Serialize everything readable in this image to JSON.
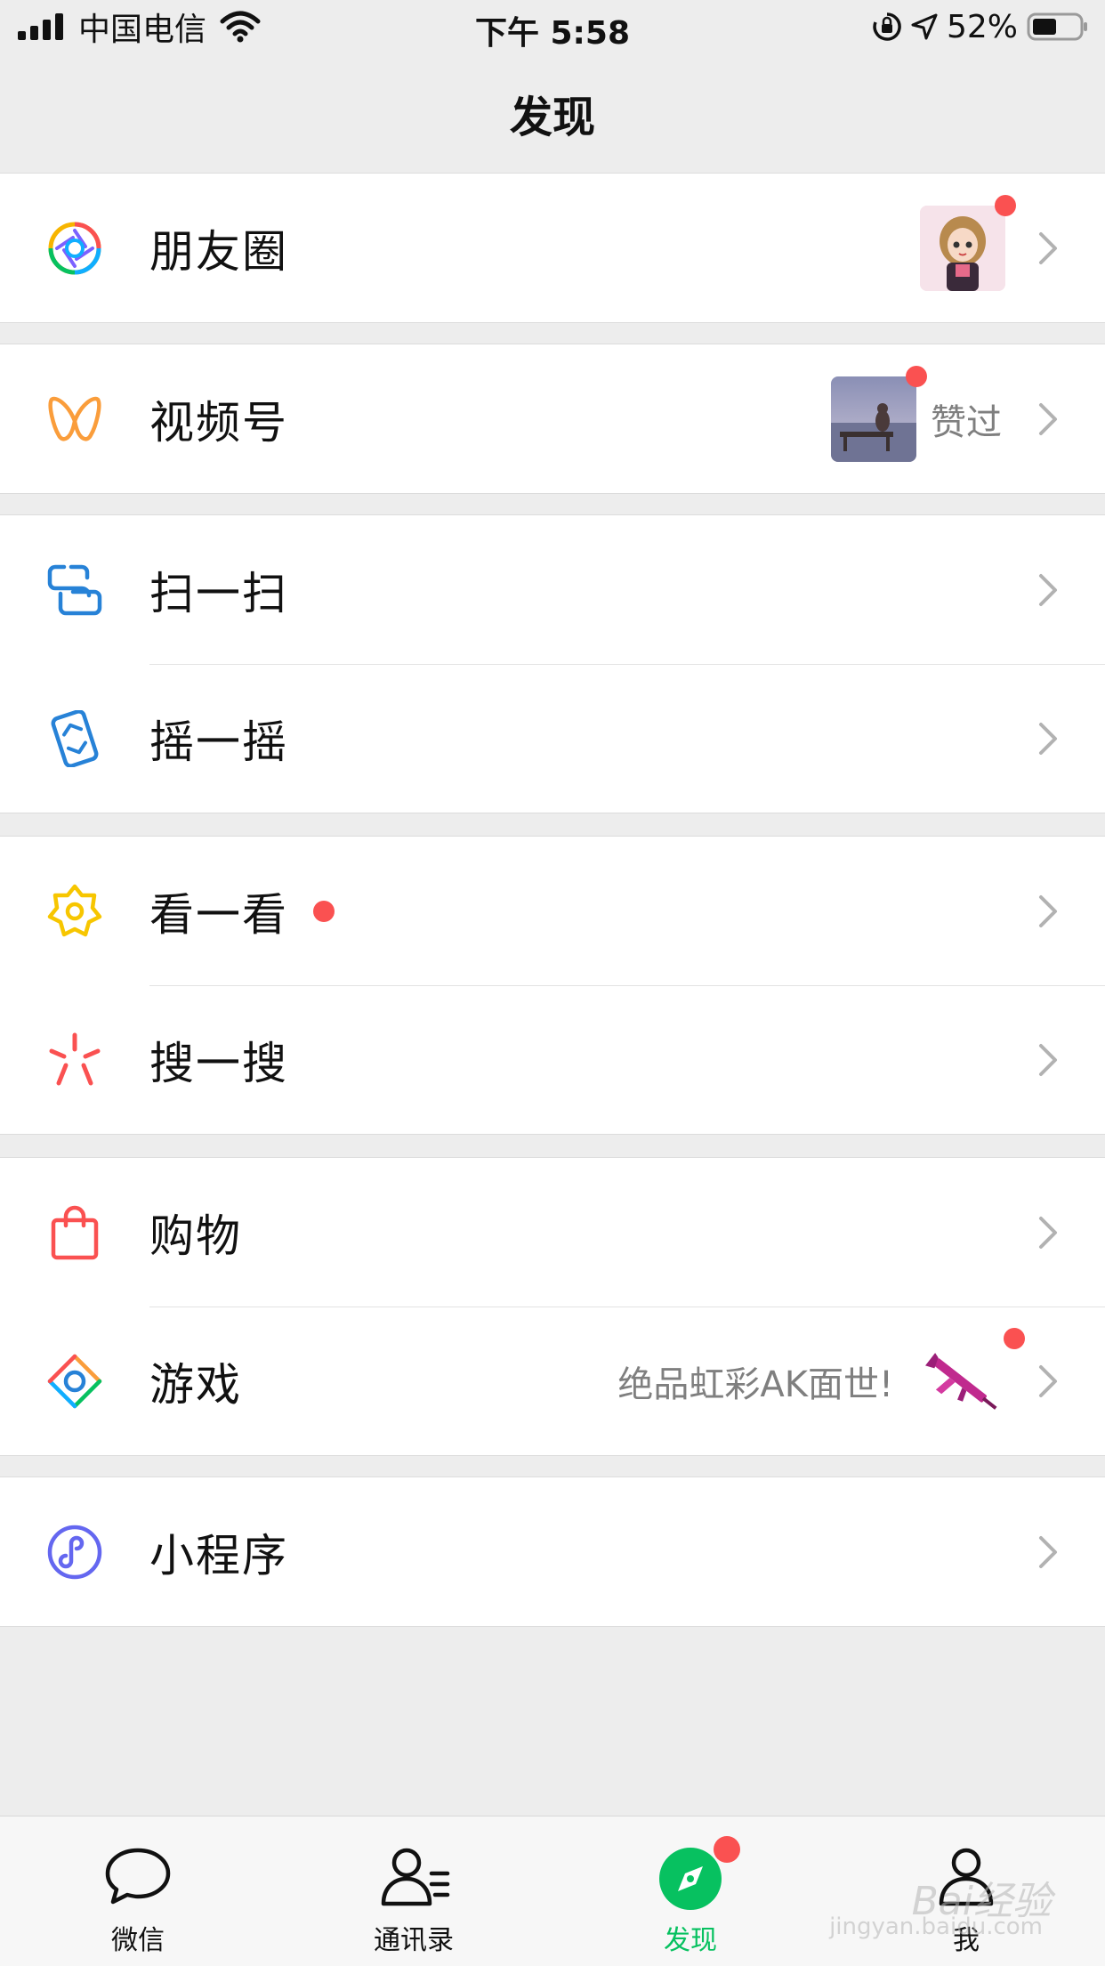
{
  "status_bar": {
    "carrier": "中国电信",
    "time": "下午 5:58",
    "battery": "52%"
  },
  "nav": {
    "title": "发现"
  },
  "groups": [
    {
      "items": [
        {
          "label": "朋友圈",
          "icon": "moments-shutter-icon",
          "has_thumb_dot": true
        }
      ]
    },
    {
      "items": [
        {
          "label": "视频号",
          "icon": "channels-butterfly-icon",
          "subtext": "赞过",
          "has_thumb_dot": true
        }
      ]
    },
    {
      "items": [
        {
          "label": "扫一扫",
          "icon": "scan-icon"
        },
        {
          "label": "摇一摇",
          "icon": "shake-icon"
        }
      ]
    },
    {
      "items": [
        {
          "label": "看一看",
          "icon": "top-stories-icon",
          "has_dot": true
        },
        {
          "label": "搜一搜",
          "icon": "search-spark-icon"
        }
      ]
    },
    {
      "items": [
        {
          "label": "购物",
          "icon": "shopping-bag-icon"
        },
        {
          "label": "游戏",
          "icon": "games-diamond-icon",
          "subtext": "绝品虹彩AK面世!",
          "has_thumb_dot": true
        }
      ]
    },
    {
      "items": [
        {
          "label": "小程序",
          "icon": "mini-program-icon"
        }
      ]
    }
  ],
  "tabbar": {
    "tabs": [
      {
        "label": "微信",
        "icon": "chat-bubble-icon"
      },
      {
        "label": "通讯录",
        "icon": "contacts-icon"
      },
      {
        "label": "发现",
        "icon": "discover-compass-icon",
        "active": true,
        "has_dot": true
      },
      {
        "label": "我",
        "icon": "me-person-icon"
      }
    ]
  },
  "colors": {
    "accent": "#07C160",
    "badge": "#FA5151",
    "background": "#EDEDED"
  },
  "watermark": {
    "brand": "Bai经验",
    "url": "jingyan.baidu.com"
  }
}
